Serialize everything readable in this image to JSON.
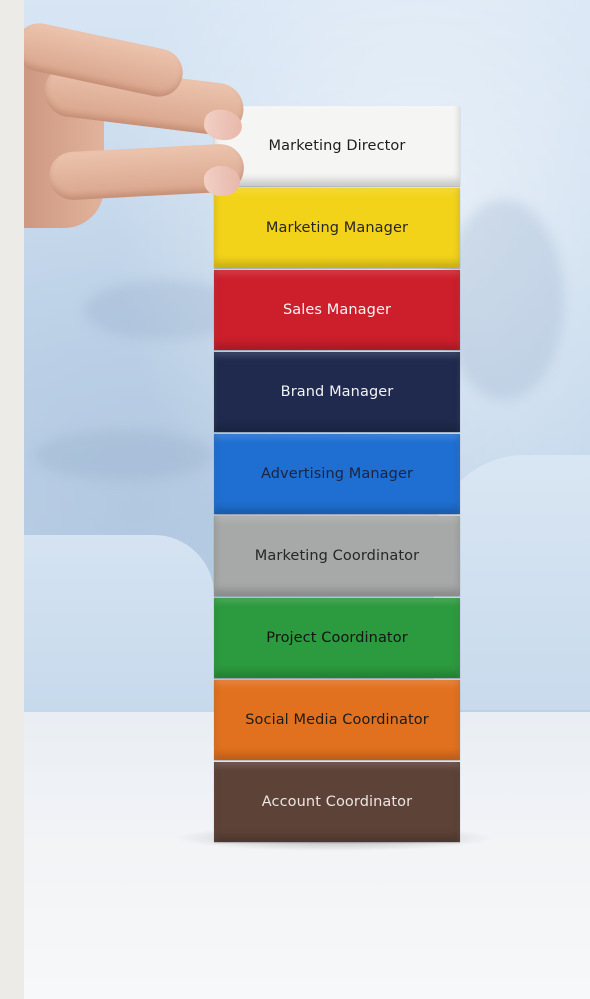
{
  "blocks": [
    {
      "label": "Marketing Director",
      "color": "#f5f5f3",
      "text_color": "#1e1e1e"
    },
    {
      "label": "Marketing Manager",
      "color": "#f3d31a",
      "text_color": "#262626"
    },
    {
      "label": "Sales Manager",
      "color": "#cc1f2b",
      "text_color": "#f4f4f4"
    },
    {
      "label": "Brand Manager",
      "color": "#1f2a4e",
      "text_color": "#f2f2f2"
    },
    {
      "label": "Advertising Manager",
      "color": "#1e6fd1",
      "text_color": "#1a2440"
    },
    {
      "label": "Marketing Coordinator",
      "color": "#a6a9a8",
      "text_color": "#262626"
    },
    {
      "label": "Project Coordinator",
      "color": "#2c9a3e",
      "text_color": "#141414"
    },
    {
      "label": "Social Media Coordinator",
      "color": "#e2711f",
      "text_color": "#1c1c1c"
    },
    {
      "label": "Account Coordinator",
      "color": "#5d4237",
      "text_color": "#ebe5e2"
    }
  ]
}
